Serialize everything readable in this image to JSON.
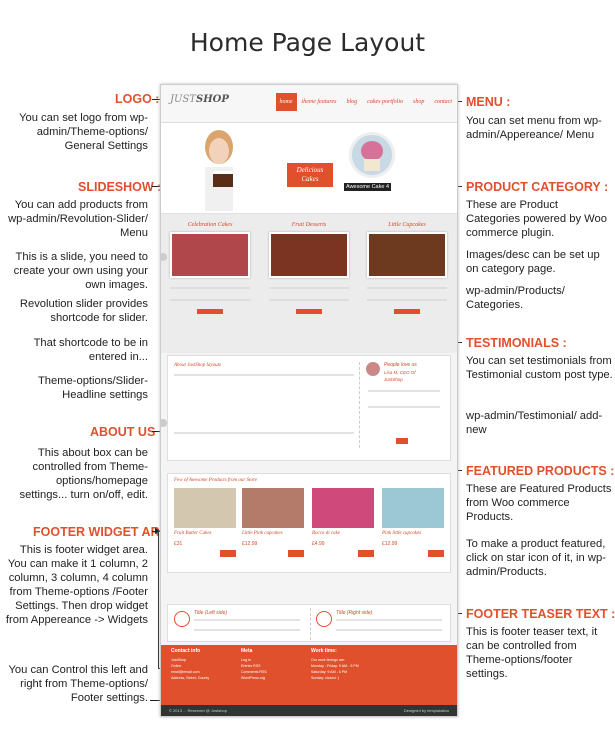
{
  "page_title": "Home Page Layout",
  "site": {
    "logo_prefix": "JUST",
    "logo_suffix": "SHOP",
    "nav": [
      "home",
      "theme features",
      "blog",
      "cakes portfolio",
      "shop",
      "contact"
    ],
    "slide_badge_1": "Delicious",
    "slide_badge_2": "Cakes",
    "slide_caption": "Awesome Cake 4",
    "categories": [
      "Celebration Cakes",
      "Fruit Desserts",
      "Little Cupcakes"
    ],
    "category_button": "view more",
    "about_title": "About JustShop layoutz",
    "testimonial_title": "People love us",
    "testimonial_name": "Lisa M, CEO Of",
    "testimonial_company": "JustShop",
    "featured_title": "Few of Awesome Products from our Store",
    "products": [
      {
        "name": "Fruit Butter Cakes",
        "price": "£31",
        "add": "Add"
      },
      {
        "name": "Little Pink cupcakes",
        "price": "£12.99",
        "add": "Add"
      },
      {
        "name": "Bocca di cake",
        "price": "£4.99",
        "add": "Add"
      },
      {
        "name": "Pink little cupcakes",
        "price": "£12.99",
        "add": "Add"
      }
    ],
    "teaser_left": "Title (Left side)",
    "teaser_right": "Title (Right side)",
    "footer_cols": [
      "Contact info",
      "Meta",
      "Work time:"
    ],
    "footer_contact": [
      "JustShop",
      "Online",
      "email@email.com",
      "Address, Street, County"
    ],
    "footer_meta": [
      "Log in",
      "Entries RSS",
      "Comments RSS",
      "WordPress.org"
    ],
    "footer_work": [
      "Our work timings are:",
      "Monday - Friday: 9 AM - 9 PM",
      "Saturday: 9 AM - 6 PM",
      "Sunday: closed :)"
    ],
    "copyright": "© 2013 ... Reserved @ Justshop",
    "designed_by": "Designed by templatation"
  },
  "annotations": {
    "logo": {
      "heading": "LOGO :",
      "text": "You can set logo from wp-admin/Theme-options/ General Settings"
    },
    "slideshow": {
      "heading": "SLIDESHOW :",
      "text": "You can add products from wp-admin/Revolution-Slider/ Menu"
    },
    "slide_note_1": "This is a slide, you need to create your  own using your own images.",
    "slide_note_2": "Revolution slider provides shortcode for slider.",
    "slide_note_3": "That shortcode to be in entered in...",
    "slide_note_4": "Theme-options/Slider- Headline settings",
    "about": {
      "heading": "ABOUT US :",
      "text": "This about box can be controlled from Theme-options/homepage settings... turn on/off, edit."
    },
    "footer_widget": {
      "heading": "FOOTER WIDGET AREA :",
      "text": "This is footer widget area. You can make it 1 column, 2 column, 3 column, 4 column from Theme-options /Footer Settings. Then drop widget from Appereance -> Widgets"
    },
    "footer_lr": "You can Control this left and right from Theme-options/ Footer settings.",
    "menu": {
      "heading": "MENU :",
      "text": "You can set menu from wp-admin/Appereance/ Menu"
    },
    "product_category": {
      "heading": "PRODUCT CATEGORY :",
      "text": "These are Product Categories powered by Woo commerce plugin."
    },
    "pc_note_1": "Images/desc can be set up on category page.",
    "pc_note_2": "wp-admin/Products/ Categories.",
    "testimonials": {
      "heading": "TESTIMONIALS :",
      "text": "You can set testimonials from Testimonial custom post type."
    },
    "testimonials_path": "wp-admin/Testimonial/ add-new",
    "featured": {
      "heading": "FEATURED PRODUCTS :",
      "text": "These are Featured Products from Woo commerce Products."
    },
    "featured_note": "To make a product featured, click on star icon of it, in wp-admin/Products.",
    "teaser": {
      "heading": "FOOTER TEASER TEXT :",
      "text": "This is footer teaser text, it can be controlled from Theme-options/footer settings."
    }
  }
}
